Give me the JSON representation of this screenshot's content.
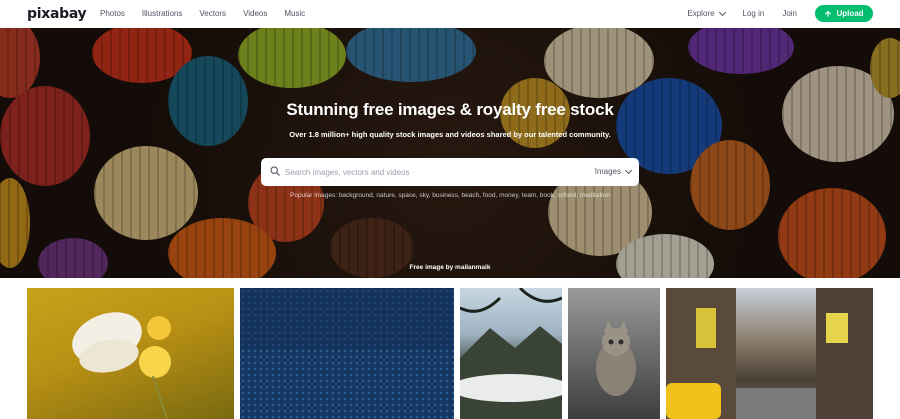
{
  "header": {
    "logo": "pixabay",
    "nav": [
      "Photos",
      "Illustrations",
      "Vectors",
      "Videos",
      "Music"
    ],
    "explore": "Explore",
    "login": "Log in",
    "join": "Join",
    "upload": "Upload"
  },
  "hero": {
    "title": "Stunning free images & royalty free stock",
    "subtitle": "Over 1.8 million+ high quality stock images and videos shared by our talented community.",
    "search_placeholder": "Search images, vectors and videos",
    "search_type": "Images",
    "popular": "Popular images: background, nature, space, sky, business, beach, food, money, team, book, school, meditation",
    "credit": "Free image by mailanmaik"
  },
  "colors": {
    "accent": "#02be6e",
    "text": "#191b26",
    "nav_text": "#505565"
  }
}
